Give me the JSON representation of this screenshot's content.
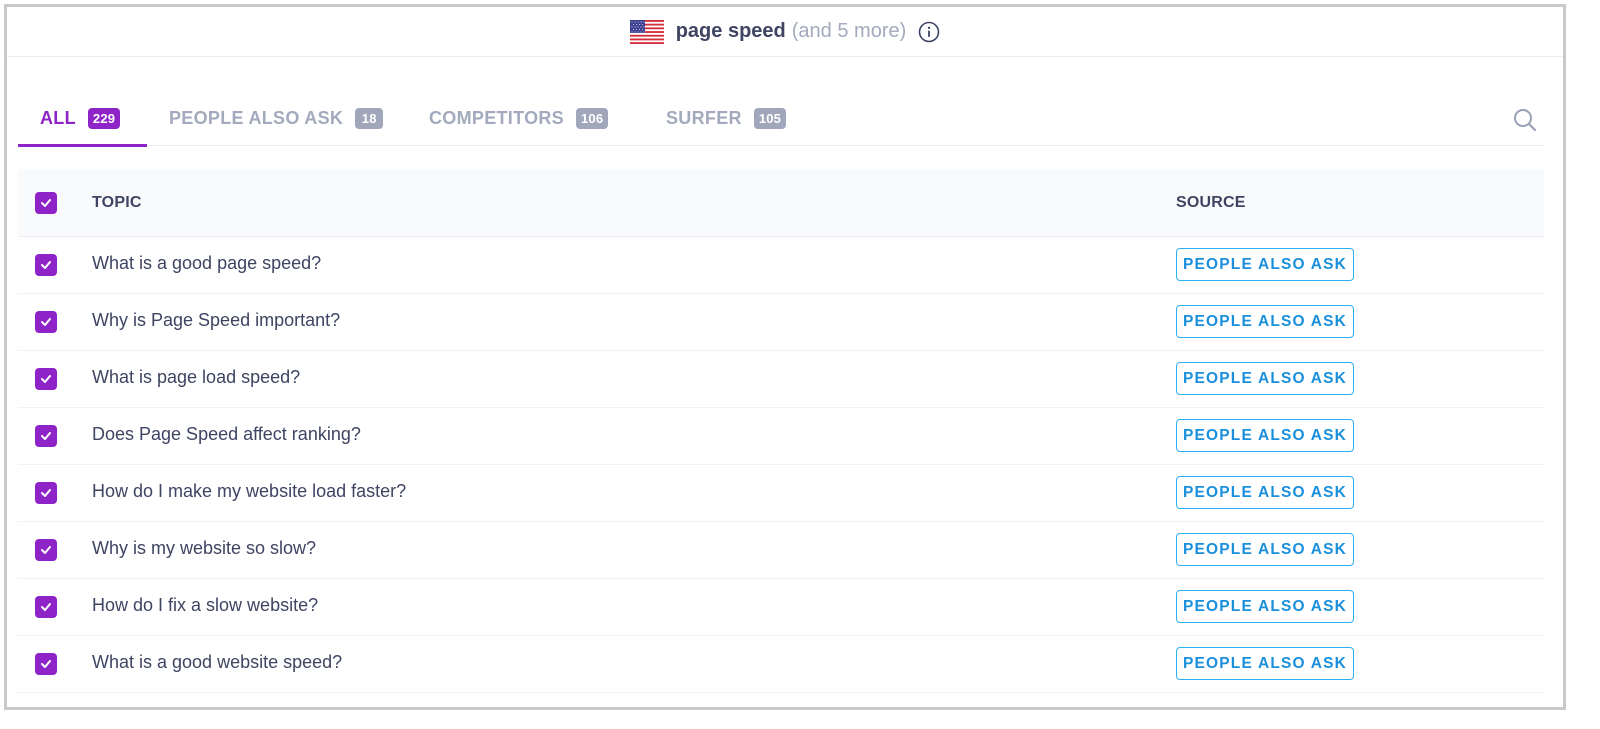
{
  "header": {
    "flag_icon": "us-flag-icon",
    "keyword": "page speed",
    "more": "(and 5 more)",
    "info_icon": "info-icon"
  },
  "tabs": [
    {
      "label": "ALL",
      "count": "229",
      "active": true
    },
    {
      "label": "PEOPLE ALSO ASK",
      "count": "18",
      "active": false
    },
    {
      "label": "COMPETITORS",
      "count": "106",
      "active": false
    },
    {
      "label": "SURFER",
      "count": "105",
      "active": false
    }
  ],
  "search_icon": "search-icon",
  "table": {
    "columns": {
      "topic": "TOPIC",
      "source": "SOURCE"
    },
    "select_all_checked": true,
    "rows": [
      {
        "topic": "What is a good page speed?",
        "source": "PEOPLE ALSO ASK",
        "checked": true
      },
      {
        "topic": "Why is Page Speed important?",
        "source": "PEOPLE ALSO ASK",
        "checked": true
      },
      {
        "topic": "What is page load speed?",
        "source": "PEOPLE ALSO ASK",
        "checked": true
      },
      {
        "topic": "Does Page Speed affect ranking?",
        "source": "PEOPLE ALSO ASK",
        "checked": true
      },
      {
        "topic": "How do I make my website load faster?",
        "source": "PEOPLE ALSO ASK",
        "checked": true
      },
      {
        "topic": "Why is my website so slow?",
        "source": "PEOPLE ALSO ASK",
        "checked": true
      },
      {
        "topic": "How do I fix a slow website?",
        "source": "PEOPLE ALSO ASK",
        "checked": true
      },
      {
        "topic": "What is a good website speed?",
        "source": "PEOPLE ALSO ASK",
        "checked": true
      }
    ]
  },
  "colors": {
    "accent": "#8e24c7",
    "tag_blue": "#1a8fdc",
    "muted": "#a3aabd",
    "text": "#3e4462"
  }
}
